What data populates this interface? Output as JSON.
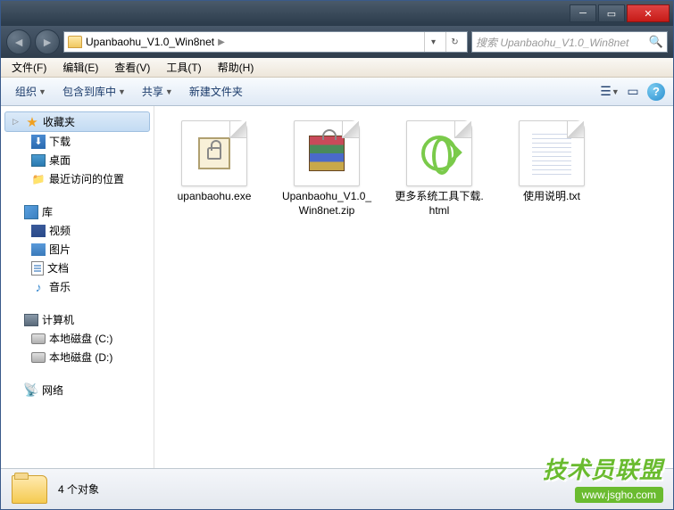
{
  "window": {
    "breadcrumb": "Upanbaohu_V1.0_Win8net",
    "search_placeholder": "搜索 Upanbaohu_V1.0_Win8net"
  },
  "menu": {
    "file": "文件(F)",
    "edit": "编辑(E)",
    "view": "查看(V)",
    "tools": "工具(T)",
    "help": "帮助(H)"
  },
  "toolbar": {
    "organize": "组织",
    "include": "包含到库中",
    "share": "共享",
    "newfolder": "新建文件夹"
  },
  "sidebar": {
    "favorites": "收藏夹",
    "downloads": "下载",
    "desktop": "桌面",
    "recent": "最近访问的位置",
    "libraries": "库",
    "videos": "视频",
    "pictures": "图片",
    "documents": "文档",
    "music": "音乐",
    "computer": "计算机",
    "diskc": "本地磁盘 (C:)",
    "diskd": "本地磁盘 (D:)",
    "network": "网络"
  },
  "files": [
    {
      "name": "upanbaohu.exe",
      "type": "exe"
    },
    {
      "name": "Upanbaohu_V1.0_Win8net.zip",
      "type": "zip"
    },
    {
      "name": "更多系统工具下载.html",
      "type": "html"
    },
    {
      "name": "使用说明.txt",
      "type": "txt"
    }
  ],
  "status": {
    "count": "4 个对象"
  },
  "watermark": {
    "main": "技术员联盟",
    "sub": "www.jsgho.com"
  }
}
